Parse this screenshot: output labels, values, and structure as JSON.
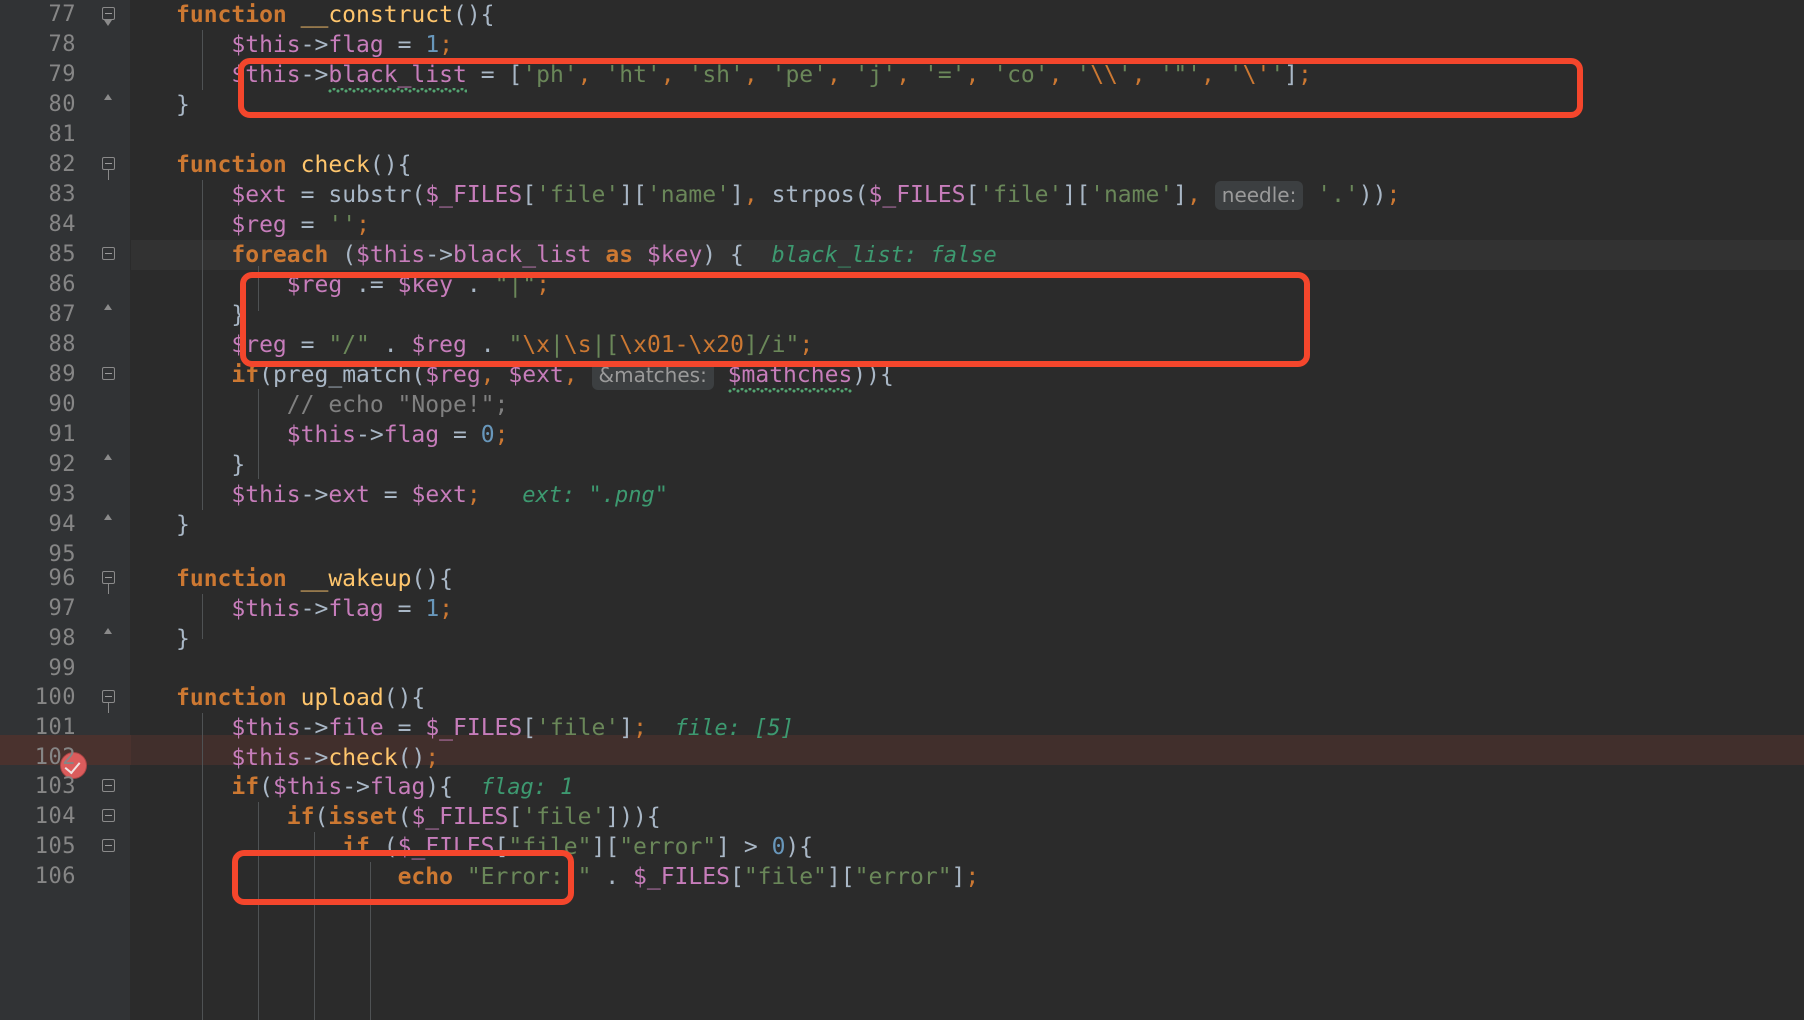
{
  "editor": {
    "app": "php-code-editor-debugger",
    "language": "PHP",
    "theme_bg": "#2b2b2b",
    "gutter_bg": "#313335",
    "accent_annotation": "#f4462c",
    "exec_line_bg": "#412f2c",
    "first_line": 77,
    "last_line": 106
  },
  "colors": {
    "keyword": "#cc7832",
    "function": "#ffc66d",
    "variable": "#c77dbb",
    "string": "#6a8759",
    "number": "#6897bb",
    "comment": "#808080",
    "default_text": "#a9b7c6",
    "inline_value_hint": "#3d9970",
    "param_hint": "#9a9a9a",
    "line_number": "#868686",
    "annotation_red": "#f4462c",
    "breakpoint_red": "#db5c5c"
  },
  "lines": [
    {
      "no": "77",
      "text": "function __construct(){"
    },
    {
      "no": "78",
      "text": "    $this->flag = 1;"
    },
    {
      "no": "79",
      "text": "    $this->black_list = ['ph', 'ht', 'sh', 'pe', 'j', '=', 'co', '\\\\', '\"', '\\'' ];"
    },
    {
      "no": "80",
      "text": "}"
    },
    {
      "no": "81",
      "text": ""
    },
    {
      "no": "82",
      "text": "function check(){"
    },
    {
      "no": "83",
      "text": "    $ext = substr($_FILES['file']['name'], strpos($_FILES['file']['name'],  needle: '.'));"
    },
    {
      "no": "84",
      "text": "    $reg = '';"
    },
    {
      "no": "85",
      "text": "    foreach ($this->black_list as $key) {   black_list: false"
    },
    {
      "no": "86",
      "text": "        $reg .= $key . \"|\";"
    },
    {
      "no": "87",
      "text": "    }"
    },
    {
      "no": "88",
      "text": "    $reg = \"/\" . $reg . \"\\x|\\s|[\\x01-\\x20]/i\";"
    },
    {
      "no": "89",
      "text": "    if(preg_match($reg, $ext,  &matches: $mathches)){"
    },
    {
      "no": "90",
      "text": "        // echo \"Nope!\";"
    },
    {
      "no": "91",
      "text": "        $this->flag = 0;"
    },
    {
      "no": "92",
      "text": "    }"
    },
    {
      "no": "93",
      "text": "    $this->ext = $ext;   ext: \".png\""
    },
    {
      "no": "94",
      "text": "}"
    },
    {
      "no": "95",
      "text": ""
    },
    {
      "no": "96",
      "text": "function __wakeup(){"
    },
    {
      "no": "97",
      "text": "    $this->flag = 1;"
    },
    {
      "no": "98",
      "text": "}"
    },
    {
      "no": "99",
      "text": ""
    },
    {
      "no": "100",
      "text": "function upload(){"
    },
    {
      "no": "101",
      "text": "    $this->file = $_FILES['file'];   file: [5]"
    },
    {
      "no": "102",
      "text": "    $this->check();"
    },
    {
      "no": "103",
      "text": "    if($this->flag){   flag: 1"
    },
    {
      "no": "104",
      "text": "        if(isset($_FILES['file'])){"
    },
    {
      "no": "105",
      "text": "            if ($_FILES[\"file\"][\"error\"] > 0){"
    },
    {
      "no": "106",
      "text": "                echo \"Error: \" . $_FILES[\"file\"][\"error\"];"
    }
  ],
  "tokens": {
    "kw_function": "function",
    "kw_foreach": "foreach",
    "kw_as": "as",
    "kw_if": "if",
    "kw_isset": "isset",
    "kw_echo": "echo",
    "fn_construct": "__construct",
    "fn_check": "check",
    "fn_wakeup": "__wakeup",
    "fn_upload": "upload",
    "fn_substr": "substr",
    "fn_strpos": "strpos",
    "fn_preg_match": "preg_match"
  },
  "inline_hints": {
    "param_needle": "needle:",
    "param_matches": "&matches:",
    "value_black_list": "black_list: false",
    "value_ext": "ext: \".png\"",
    "value_file": "file: [5]",
    "value_flag": "flag: 1"
  },
  "black_list_array": [
    "ph",
    "ht",
    "sh",
    "pe",
    "j",
    "=",
    "co",
    "\\\\",
    "\"",
    "'"
  ],
  "annotations": [
    {
      "name": "black-list-highlight",
      "line": "79",
      "label": "$this->black_list = [...]"
    },
    {
      "name": "foreach-loop-highlight",
      "line": "85-87",
      "label": "foreach ($this->black_list as $key) { ... }"
    },
    {
      "name": "check-call-highlight",
      "line": "102",
      "label": "$this->check();"
    }
  ],
  "breakpoint": {
    "line": "102",
    "state": "verified",
    "icon": "breakpoint-check-icon"
  },
  "execution_line": "102"
}
